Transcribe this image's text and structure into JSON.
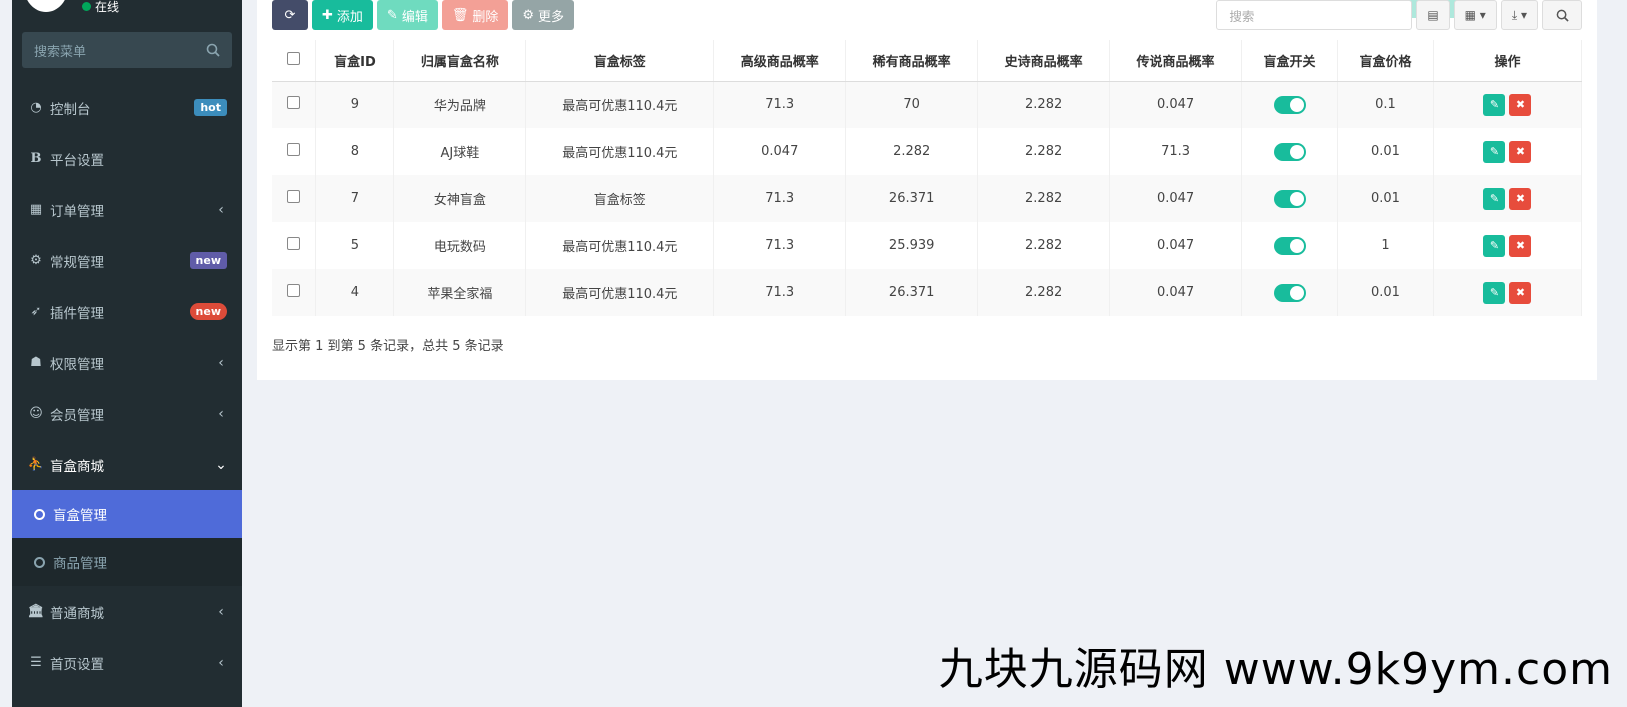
{
  "sidebar": {
    "status_text": "在线",
    "search_placeholder": "搜索菜单",
    "items": [
      {
        "label": "控制台",
        "badge": "hot"
      },
      {
        "label": "平台设置"
      },
      {
        "label": "订单管理"
      },
      {
        "label": "常规管理",
        "badge": "new"
      },
      {
        "label": "插件管理",
        "badge": "new"
      },
      {
        "label": "权限管理"
      },
      {
        "label": "会员管理"
      },
      {
        "label": "盲盒商城"
      },
      {
        "label": "普通商城"
      },
      {
        "label": "首页设置"
      }
    ],
    "subitems": [
      {
        "label": "盲盒管理"
      },
      {
        "label": "商品管理"
      }
    ]
  },
  "toolbar": {
    "add": "添加",
    "edit": "编辑",
    "delete": "删除",
    "more": "更多",
    "search_placeholder": "搜索"
  },
  "table": {
    "headers": [
      "盲盒ID",
      "归属盲盒名称",
      "盲盒标签",
      "高级商品概率",
      "稀有商品概率",
      "史诗商品概率",
      "传说商品概率",
      "盲盒开关",
      "盲盒价格",
      "操作"
    ],
    "rows": [
      {
        "id": "9",
        "name": "华为品牌",
        "tag": "最高可优惠110.4元",
        "p1": "71.3",
        "p2": "70",
        "p3": "2.282",
        "p4": "0.047",
        "price": "0.1"
      },
      {
        "id": "8",
        "name": "AJ球鞋",
        "tag": "最高可优惠110.4元",
        "p1": "0.047",
        "p2": "2.282",
        "p3": "2.282",
        "p4": "71.3",
        "price": "0.01"
      },
      {
        "id": "7",
        "name": "女神盲盒",
        "tag": "盲盒标签",
        "p1": "71.3",
        "p2": "26.371",
        "p3": "2.282",
        "p4": "0.047",
        "price": "0.01"
      },
      {
        "id": "5",
        "name": "电玩数码",
        "tag": "最高可优惠110.4元",
        "p1": "71.3",
        "p2": "25.939",
        "p3": "2.282",
        "p4": "0.047",
        "price": "1"
      },
      {
        "id": "4",
        "name": "苹果全家福",
        "tag": "最高可优惠110.4元",
        "p1": "71.3",
        "p2": "26.371",
        "p3": "2.282",
        "p4": "0.047",
        "price": "0.01"
      }
    ]
  },
  "pager_text": "显示第 1 到第 5 条记录，总共 5 条记录",
  "watermark": "九块九源码网 www.9k9ym.com",
  "colors": {
    "accent": "#18bc9c",
    "sidebar": "#222d32",
    "active": "#4f6bd9",
    "danger": "#e74c3c"
  }
}
